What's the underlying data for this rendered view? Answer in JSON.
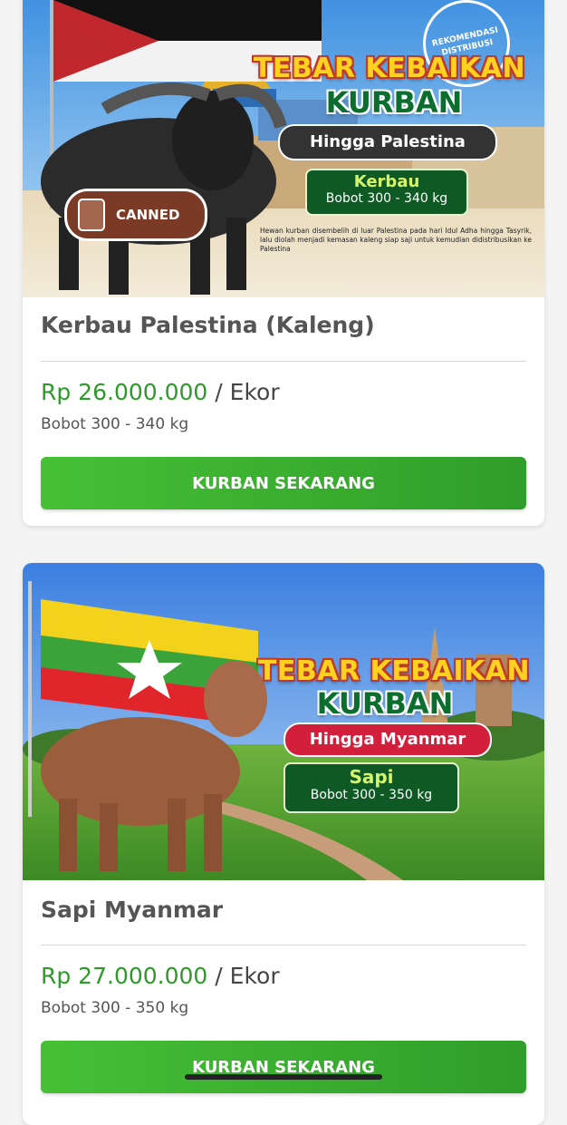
{
  "products": [
    {
      "name": "Kerbau Palestina (Kaleng)",
      "price": "Rp 26.000.000",
      "unit": "/ Ekor",
      "weight": "Bobot 300 - 340 kg",
      "button_label": "KURBAN SEKARANG",
      "banner": {
        "headline_1": "TEBAR KEBAIKAN",
        "headline_2": "KURBAN",
        "destination": "Hingga Palestina",
        "animal": "Kerbau",
        "animal_weight": "Bobot 300 - 340 kg",
        "badge": "CANNED",
        "seal": "REKOMENDASI DISTRIBUSI",
        "description": "Hewan kurban disembelih di luar Palestina pada hari Idul Adha hingga Tasyrik, lalu diolah menjadi kemasan kaleng siap saji untuk kemudian didistribusikan ke Palestina"
      }
    },
    {
      "name": "Sapi Myanmar",
      "price": "Rp 27.000.000",
      "unit": "/ Ekor",
      "weight": "Bobot 300 - 350 kg",
      "button_label": "KURBAN SEKARANG",
      "banner": {
        "headline_1": "TEBAR KEBAIKAN",
        "headline_2": "KURBAN",
        "destination": "Hingga Myanmar",
        "animal": "Sapi",
        "animal_weight": "Bobot 300 - 350 kg"
      }
    }
  ],
  "colors": {
    "accent_green": "#2e9a2a",
    "button_gradient_start": "#46c035",
    "button_gradient_end": "#2f9e2a",
    "title_gray": "#555555"
  }
}
